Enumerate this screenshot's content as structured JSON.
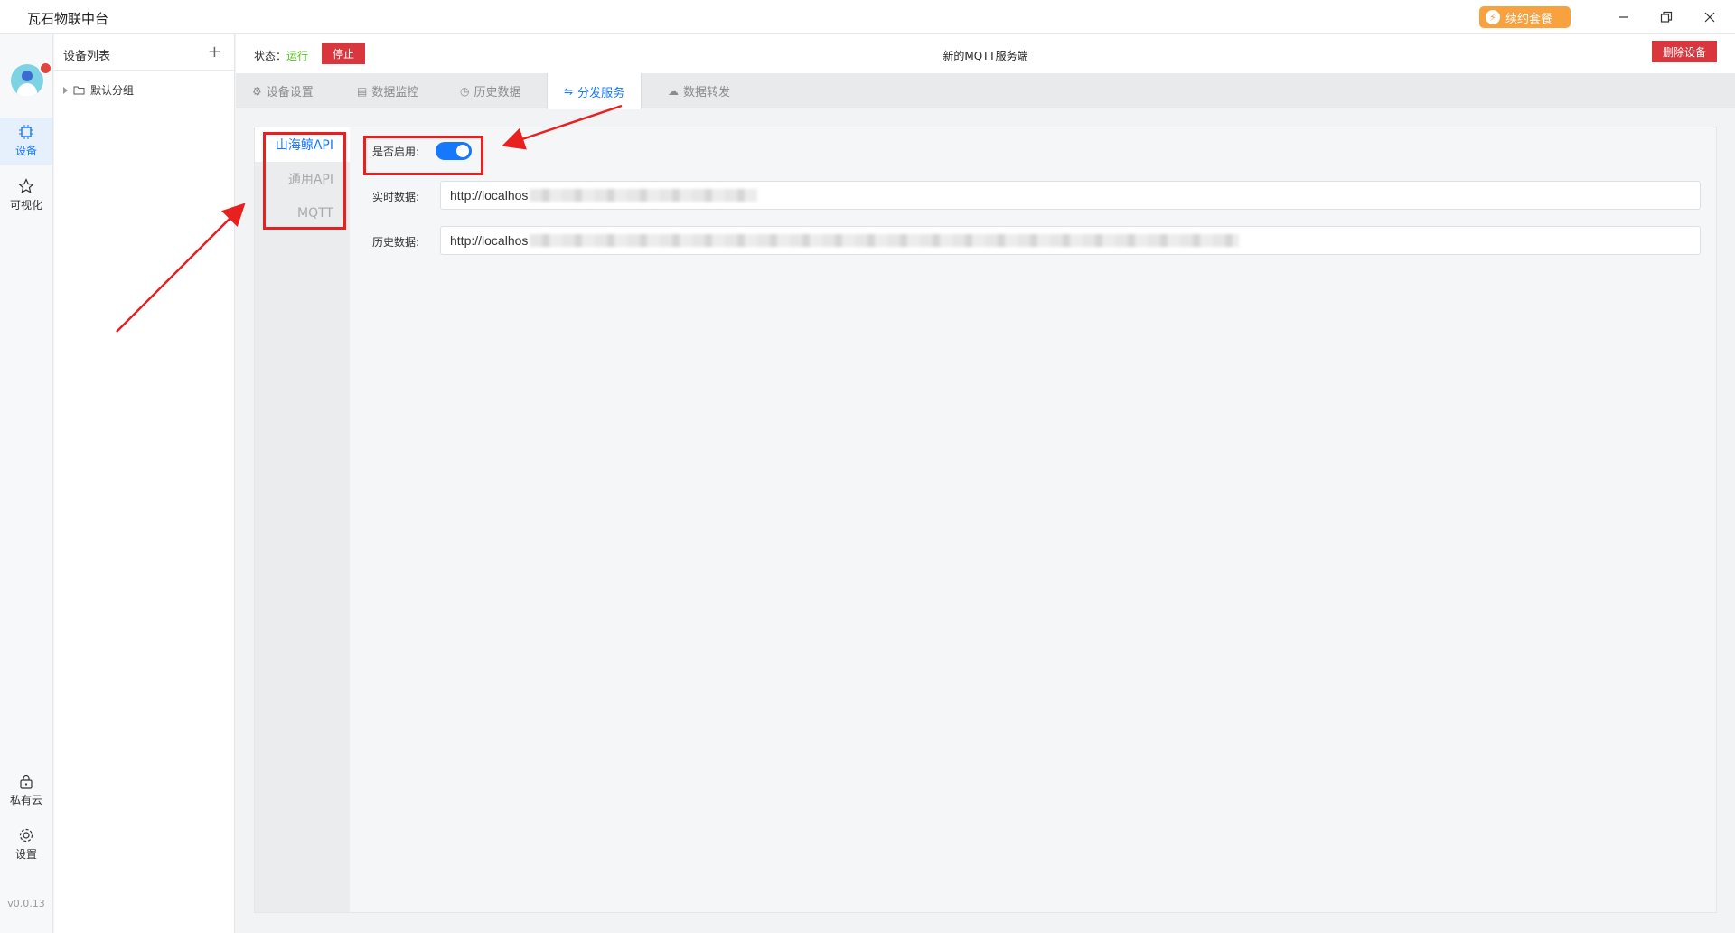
{
  "window": {
    "title": "瓦石物联中台",
    "renew_label": "续约套餐"
  },
  "rail": {
    "items": [
      {
        "label": "设备",
        "icon": "chip-icon"
      },
      {
        "label": "可视化",
        "icon": "star-icon"
      },
      {
        "label": "私有云",
        "icon": "lock-icon"
      },
      {
        "label": "设置",
        "icon": "gear-icon"
      }
    ],
    "version": "v0.0.13"
  },
  "device_list": {
    "title": "设备列表",
    "add_symbol": "+",
    "groups": [
      {
        "label": "默认分组"
      }
    ]
  },
  "statusbar": {
    "status_label": "状态：",
    "status_value": "运行",
    "stop_label": "停止",
    "device_name": "新的MQTT服务端",
    "delete_label": "删除设备"
  },
  "tabs": [
    {
      "label": "设备设置",
      "icon": "gear-icon"
    },
    {
      "label": "数据监控",
      "icon": "database-icon"
    },
    {
      "label": "历史数据",
      "icon": "clock-icon"
    },
    {
      "label": "分发服务",
      "icon": "exchange-icon",
      "active": true
    },
    {
      "label": "数据转发",
      "icon": "cloud-icon"
    }
  ],
  "subnav": [
    {
      "label": "山海鲸API",
      "active": true
    },
    {
      "label": "通用API"
    },
    {
      "label": "MQTT"
    }
  ],
  "form": {
    "enable_label": "是否启用:",
    "enabled": true,
    "realtime_label": "实时数据:",
    "realtime_value": "http://localhos",
    "history_label": "历史数据:",
    "history_value": "http://localhos"
  },
  "colors": {
    "accent": "#1677ff",
    "danger": "#d9363e",
    "running": "#52c41a",
    "renew": "#f7a13f",
    "annotation": "#e8201f"
  }
}
